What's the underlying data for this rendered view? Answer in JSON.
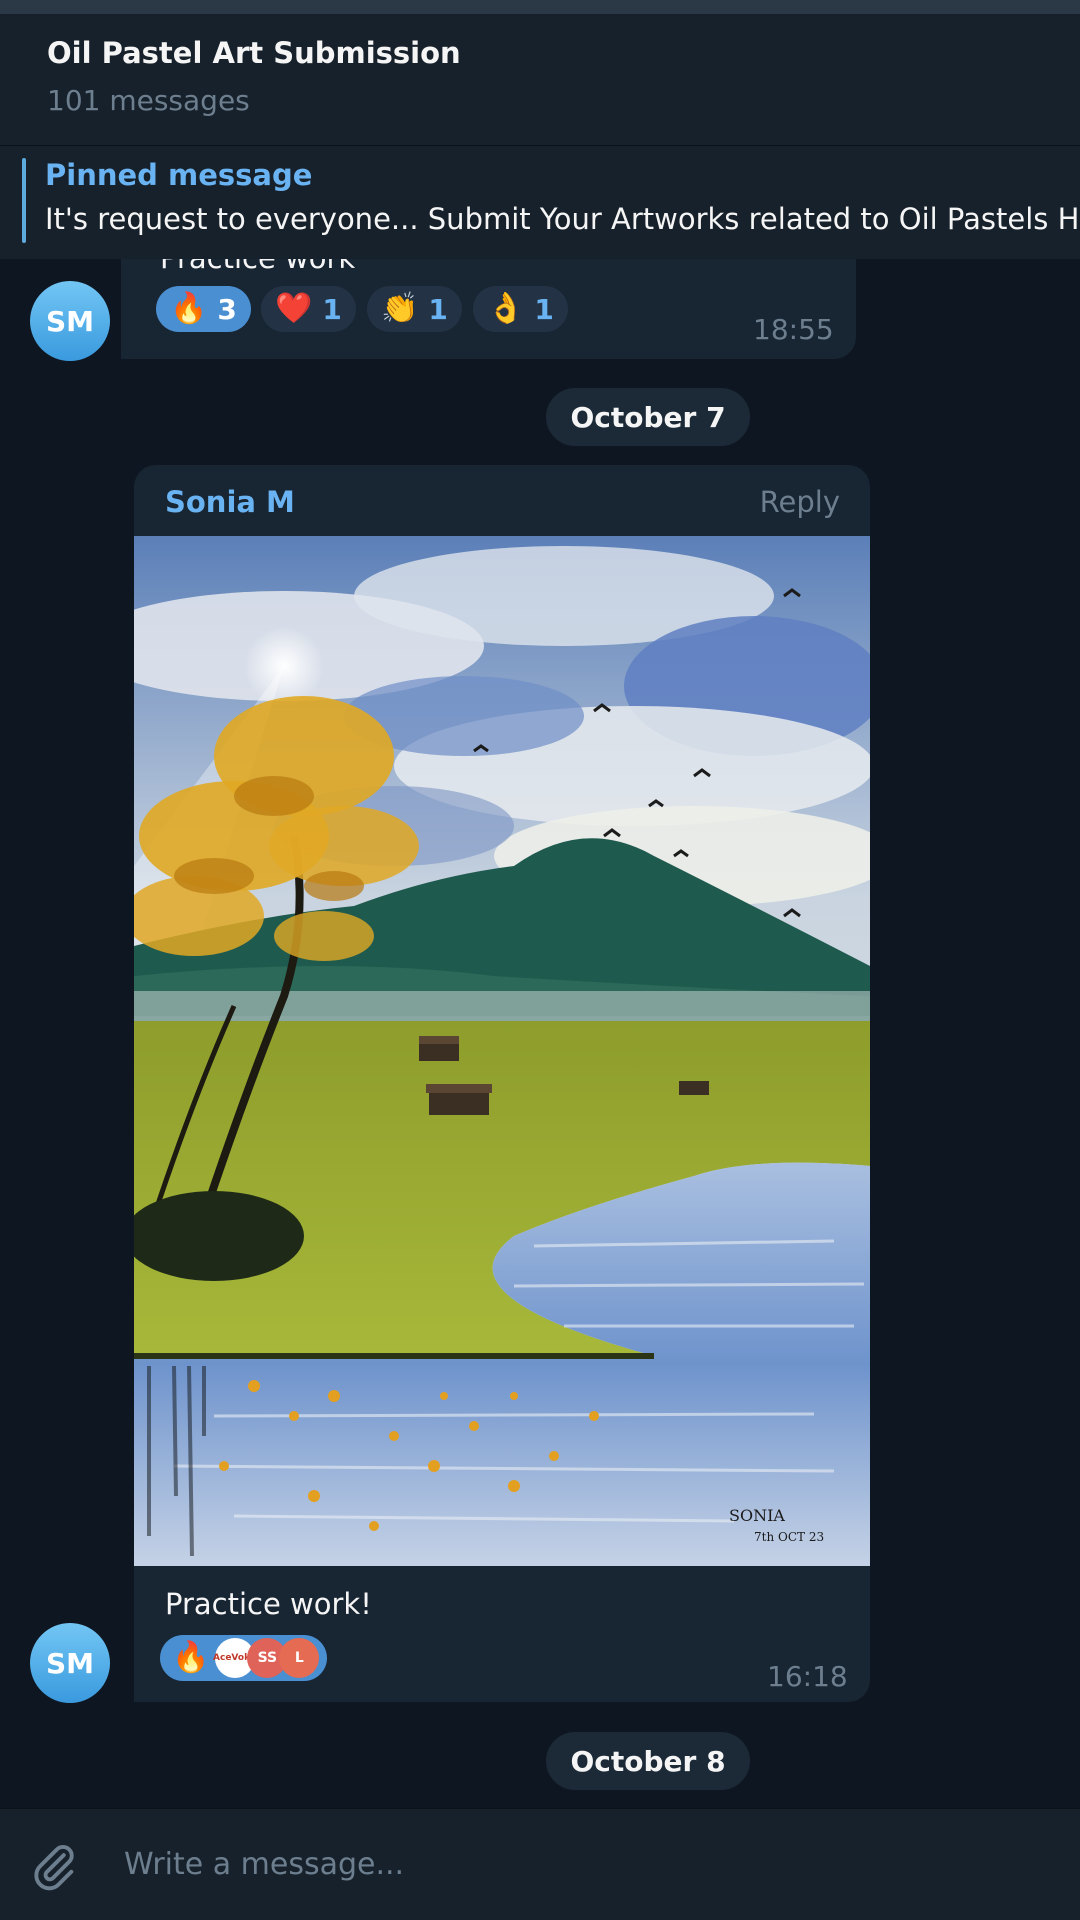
{
  "header": {
    "title": "Oil Pastel Art Submission",
    "subtitle": "101 messages"
  },
  "pinned": {
    "label": "Pinned message",
    "text": "It's request to everyone... Submit Your Artworks related to Oil Pastels H"
  },
  "messages": [
    {
      "avatar": "SM",
      "caption_partial": "Practice work",
      "reactions": [
        {
          "emoji": "🔥",
          "count": "3",
          "chosen": true
        },
        {
          "emoji": "❤️",
          "count": "1"
        },
        {
          "emoji": "👏",
          "count": "1"
        },
        {
          "emoji": "👌",
          "count": "1"
        }
      ],
      "time": "18:55"
    },
    {
      "date": "October 7"
    },
    {
      "avatar": "SM",
      "sender": "Sonia M",
      "reply_label": "Reply",
      "photo_signature": "SONIA",
      "photo_date": "7th OCT 23",
      "caption": "Practice work!",
      "reactions": [
        {
          "emoji": "🔥"
        },
        {
          "sticker": "AceVokO"
        },
        {
          "sticker": "SS"
        },
        {
          "sticker": "L"
        }
      ],
      "time": "16:18"
    },
    {
      "date": "October 8"
    }
  ],
  "composer": {
    "placeholder": "Write a message..."
  },
  "colors": {
    "background": "#0e1621",
    "panel": "#17212b",
    "bubble": "#182533",
    "accent": "#6ab3f3",
    "muted": "#6d7f8f"
  }
}
